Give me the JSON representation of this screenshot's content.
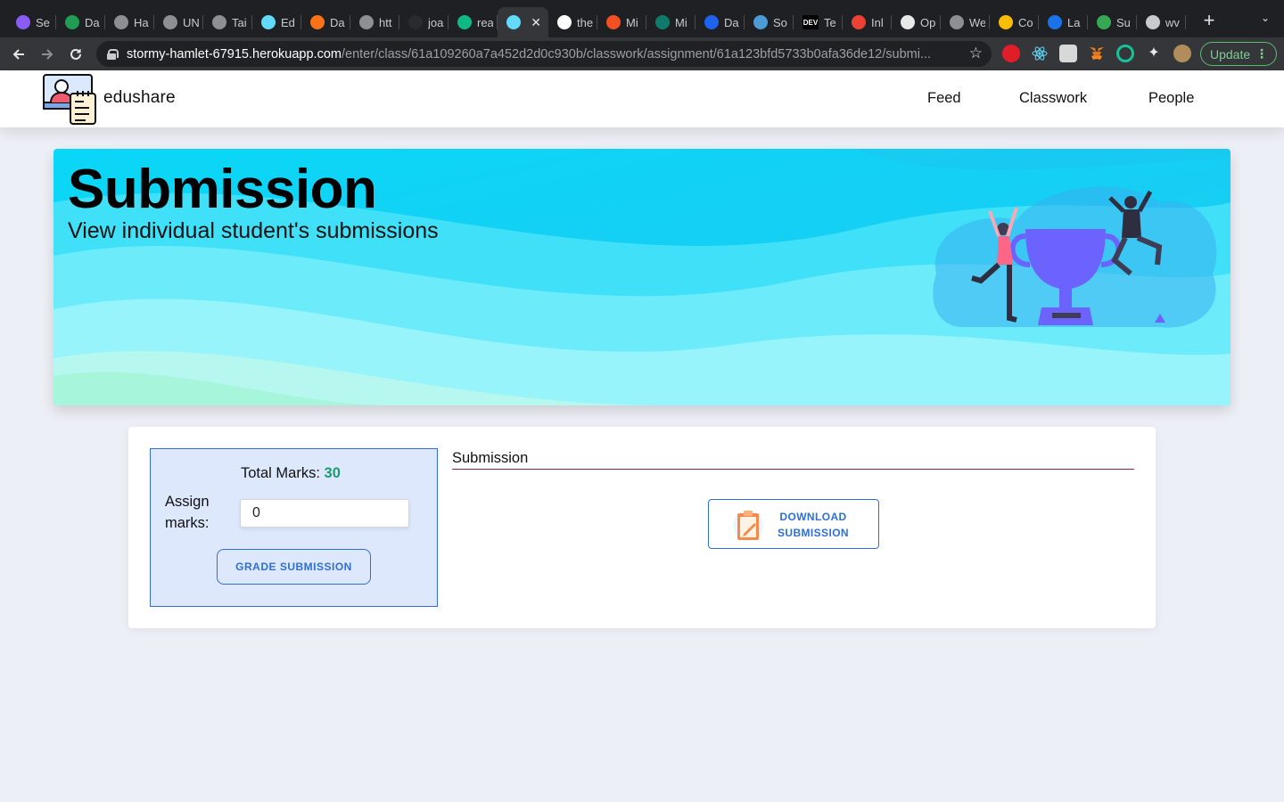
{
  "browser": {
    "tabs": [
      {
        "title": "Se",
        "icon": "arc-icon",
        "color": "#8a5cf6"
      },
      {
        "title": "Da",
        "icon": "leaf-icon",
        "color": "#1f9d55"
      },
      {
        "title": "Ha",
        "icon": "globe-icon",
        "color": "#8e8f92"
      },
      {
        "title": "UN",
        "icon": "globe-icon",
        "color": "#8e8f92"
      },
      {
        "title": "Tai",
        "icon": "search-icon",
        "color": "#8e8f92"
      },
      {
        "title": "Ed",
        "icon": "react-icon",
        "color": "#61dafb"
      },
      {
        "title": "Da",
        "icon": "bracket-icon",
        "color": "#f97316"
      },
      {
        "title": "htt",
        "icon": "globe-icon",
        "color": "#8e8f92"
      },
      {
        "title": "joa",
        "icon": "circle-icon",
        "color": "#2a2b2e"
      },
      {
        "title": "rea",
        "icon": "chat-icon",
        "color": "#10b981"
      },
      {
        "title": "",
        "icon": "react-icon",
        "color": "#61dafb",
        "active": true
      },
      {
        "title": "the",
        "icon": "github-icon",
        "color": "#ffffff"
      },
      {
        "title": "Mi",
        "icon": "microsoft-icon",
        "color": "#f25022"
      },
      {
        "title": "Mi",
        "icon": "forms-icon",
        "color": "#0f7b6c"
      },
      {
        "title": "Da",
        "icon": "docker-icon",
        "color": "#1d63ed"
      },
      {
        "title": "So",
        "icon": "sonar-icon",
        "color": "#4c9bd6"
      },
      {
        "title": "Te",
        "icon": "dev-icon",
        "color": "#000000",
        "text": "DEV"
      },
      {
        "title": "Inl",
        "icon": "gmail-icon",
        "color": "#ea4335"
      },
      {
        "title": "Op",
        "icon": "openai-icon",
        "color": "#e8e8e8"
      },
      {
        "title": "We",
        "icon": "globe-icon",
        "color": "#8e8f92"
      },
      {
        "title": "Co",
        "icon": "classroom-icon",
        "color": "#fbbc04"
      },
      {
        "title": "La",
        "icon": "contacts-icon",
        "color": "#1a73e8"
      },
      {
        "title": "Su",
        "icon": "drive-icon",
        "color": "#34a853"
      },
      {
        "title": "wv",
        "icon": "page-icon",
        "color": "#c9cacd"
      }
    ],
    "close_glyph": "✕",
    "new_tab_glyph": "+",
    "tab_menu_glyph": "⌄",
    "url_host": "stormy-hamlet-67915.herokuapp.com",
    "url_path": "/enter/class/61a109260a7a452d2d0c930b/classwork/assignment/61a123bfd5733b0afa36de12/submi...",
    "update_label": "Update"
  },
  "app": {
    "brand": "edushare",
    "nav": [
      "Feed",
      "Classwork",
      "People"
    ]
  },
  "banner": {
    "title": "Submission",
    "subtitle": "View individual student's submissions"
  },
  "grading": {
    "total_label": "Total Marks: ",
    "total_value": "30",
    "assign_label": "Assign marks:",
    "marks_value": "0",
    "grade_button": "GRADE SUBMISSION"
  },
  "submission": {
    "heading": "Submission",
    "download_button": "DOWNLOAD SUBMISSION"
  },
  "colors": {
    "accent_blue": "#2f6fd6",
    "marks_green": "#199c6d",
    "panel_bg": "#dde8fd",
    "banner_cyan": "#1ad3f7"
  }
}
